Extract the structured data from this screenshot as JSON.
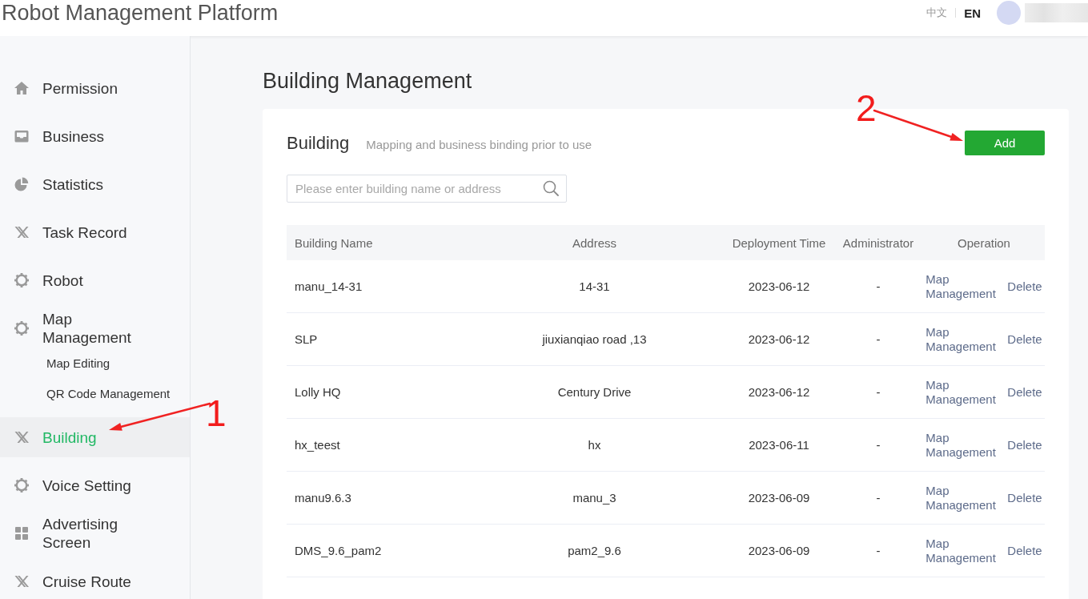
{
  "header": {
    "title": "Robot Management Platform",
    "languages": [
      {
        "label": "中文",
        "selected": false
      },
      {
        "label": "EN",
        "selected": true
      }
    ]
  },
  "sidebar": {
    "items": [
      {
        "label": "Permission",
        "selected": false
      },
      {
        "label": "Business",
        "selected": false
      },
      {
        "label": "Statistics",
        "selected": false
      },
      {
        "label": "Task Record",
        "selected": false
      },
      {
        "label": "Robot",
        "selected": false
      },
      {
        "label": "Map Management",
        "selected": false,
        "children": [
          {
            "label": "Map Editing",
            "selected": false
          },
          {
            "label": "QR Code Management",
            "selected": false
          }
        ]
      },
      {
        "label": "Building",
        "selected": true,
        "annotation": "1"
      },
      {
        "label": "Voice Setting",
        "selected": false
      },
      {
        "label": "Advertising Screen",
        "selected": false
      },
      {
        "label": "Cruise Route",
        "selected": false
      }
    ]
  },
  "page_title": "Building Management",
  "card": {
    "title": "Building",
    "subtitle": "Mapping and business binding prior to use",
    "add_button": {
      "label": "Add",
      "annotation": "2"
    },
    "search": {
      "placeholder": "Please enter building name or address"
    },
    "table": {
      "columns": [
        "Building Name",
        "Address",
        "Deployment Time",
        "Administrator",
        "Operation"
      ],
      "rows": [
        {
          "cells": [
            "manu_14-31",
            "14-31",
            "2023-06-12",
            "-"
          ],
          "actions": [
            "Map Management",
            "Delete"
          ]
        },
        {
          "cells": [
            "SLP",
            "jiuxianqiao road ,13",
            "2023-06-12",
            "-"
          ],
          "actions": [
            "Map Management",
            "Delete"
          ]
        },
        {
          "cells": [
            "Lolly HQ",
            "Century Drive",
            "2023-06-12",
            "-"
          ],
          "actions": [
            "Map Management",
            "Delete"
          ]
        },
        {
          "cells": [
            "hx_teest",
            "hx",
            "2023-06-11",
            "-"
          ],
          "actions": [
            "Map Management",
            "Delete"
          ]
        },
        {
          "cells": [
            "manu9.6.3",
            "manu_3",
            "2023-06-09",
            "-"
          ],
          "actions": [
            "Map Management",
            "Delete"
          ]
        },
        {
          "cells": [
            "DMS_9.6_pam2",
            "pam2_9.6",
            "2023-06-09",
            "-"
          ],
          "actions": [
            "Map Management",
            "Delete"
          ]
        }
      ]
    }
  }
}
